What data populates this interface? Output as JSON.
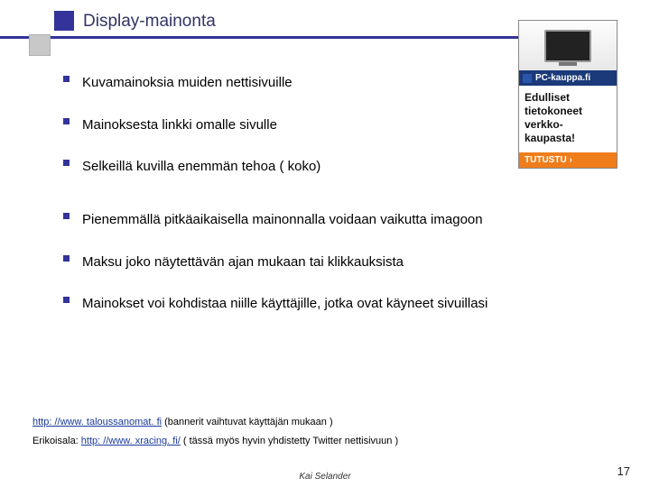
{
  "header": {
    "title": "Display-mainonta"
  },
  "ad": {
    "brand": "PC-kauppa.fi",
    "text": "Edulliset tietokoneet verkko-kaupasta!",
    "cta": "TUTUSTU ›"
  },
  "bullets_top": [
    "Kuvamainoksia muiden nettisivuille",
    "Mainoksesta linkki omalle sivulle",
    "Selkeillä kuvilla enemmän tehoa ( koko)"
  ],
  "bullets_bottom": [
    "Pienemmällä pitkäaikaisella mainonnalla voidaan vaikutta imagoon",
    "Maksu joko näytettävän ajan mukaan tai klikkauksista",
    "Mainokset voi kohdistaa niille käyttäjille, jotka ovat käyneet sivuillasi"
  ],
  "refs": {
    "link1_text": "http: //www. taloussanomat. fi",
    "link1_url": "http://www.taloussanomat.fi",
    "link1_note": "  (bannerit vaihtuvat käyttäjän mukaan )",
    "line2_prefix": "Erikoisala: ",
    "link2_text": "http: //www. xracing. fi/",
    "link2_url": "http://www.xracing.fi/",
    "link2_note": "  ( tässä myös hyvin yhdistetty Twitter nettisivuun )"
  },
  "footer": {
    "author": "Kai Selander",
    "page": "17"
  }
}
